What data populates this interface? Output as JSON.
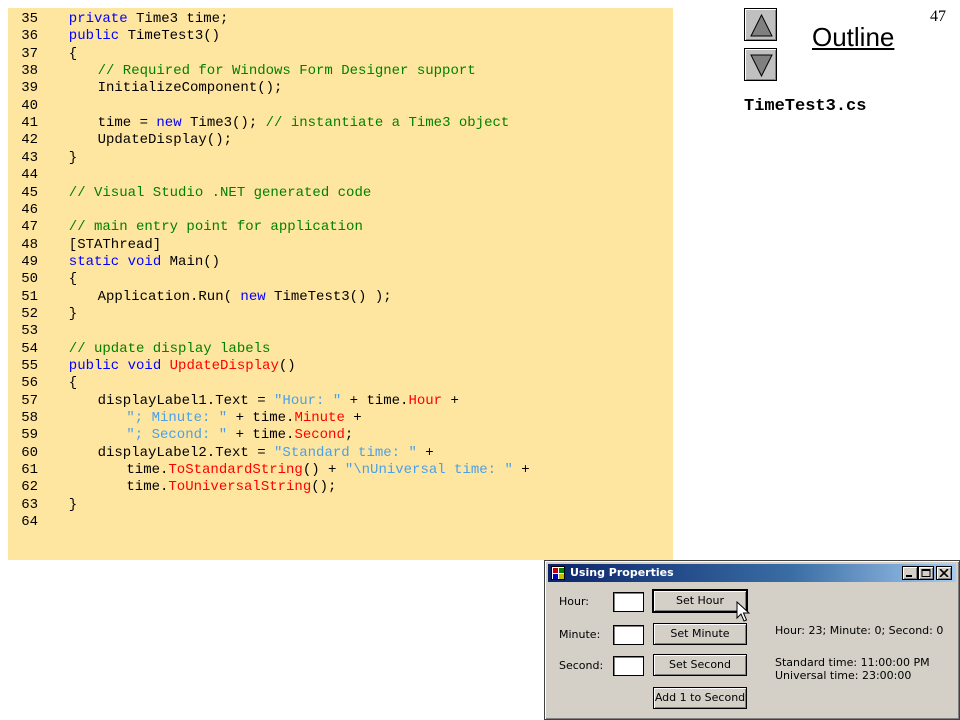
{
  "code_lines": [
    {
      "num": "35",
      "tokens": [
        {
          "t": "private Time3 time;",
          "c": "kw-mix-private"
        }
      ]
    },
    {
      "num": "36",
      "tokens": []
    },
    {
      "num": "37",
      "tokens": []
    },
    {
      "num": "38",
      "tokens": []
    }
  ],
  "code": [
    {
      "num": "35",
      "indent": 3,
      "segs": [
        [
          "kw",
          "private"
        ],
        [
          "plain",
          " Time3 time;"
        ]
      ]
    },
    {
      "num": "36",
      "indent": 3,
      "segs": [
        [
          "kw",
          "public"
        ],
        [
          "plain",
          " TimeTest3()"
        ]
      ]
    },
    {
      "num": "37",
      "indent": 3,
      "segs": [
        [
          "plain",
          "{"
        ]
      ]
    },
    {
      "num": "38",
      "indent": 6,
      "segs": [
        [
          "com",
          "// Required for Windows Form Designer support"
        ]
      ]
    },
    {
      "num": "39",
      "indent": 6,
      "segs": [
        [
          "plain",
          "InitializeComponent();"
        ]
      ]
    },
    {
      "num": "40",
      "indent": 0,
      "segs": []
    },
    {
      "num": "41",
      "indent": 6,
      "segs": [
        [
          "plain",
          "time = "
        ],
        [
          "kw",
          "new"
        ],
        [
          "plain",
          " Time3(); "
        ],
        [
          "com",
          "// instantiate a Time3 object"
        ]
      ]
    },
    {
      "num": "42",
      "indent": 6,
      "segs": [
        [
          "plain",
          "UpdateDisplay();"
        ]
      ]
    },
    {
      "num": "43",
      "indent": 3,
      "segs": [
        [
          "plain",
          "}"
        ]
      ]
    },
    {
      "num": "44",
      "indent": 0,
      "segs": []
    },
    {
      "num": "45",
      "indent": 3,
      "segs": [
        [
          "com",
          "// Visual Studio .NET generated code"
        ]
      ]
    },
    {
      "num": "46",
      "indent": 0,
      "segs": []
    },
    {
      "num": "47",
      "indent": 3,
      "segs": [
        [
          "com",
          "// main entry point for application"
        ]
      ]
    },
    {
      "num": "48",
      "indent": 3,
      "segs": [
        [
          "plain",
          "[STAThread]"
        ]
      ]
    },
    {
      "num": "49",
      "indent": 3,
      "segs": [
        [
          "kw",
          "static"
        ],
        [
          "plain",
          " "
        ],
        [
          "kw",
          "void"
        ],
        [
          "plain",
          " Main()"
        ]
      ]
    },
    {
      "num": "50",
      "indent": 3,
      "segs": [
        [
          "plain",
          "{"
        ]
      ]
    },
    {
      "num": "51",
      "indent": 6,
      "segs": [
        [
          "plain",
          "Application.Run( "
        ],
        [
          "kw",
          "new"
        ],
        [
          "plain",
          " TimeTest3() );"
        ]
      ]
    },
    {
      "num": "52",
      "indent": 3,
      "segs": [
        [
          "plain",
          "}"
        ]
      ]
    },
    {
      "num": "53",
      "indent": 0,
      "segs": []
    },
    {
      "num": "54",
      "indent": 3,
      "segs": [
        [
          "com",
          "// update display labels"
        ]
      ]
    },
    {
      "num": "55",
      "indent": 3,
      "segs": [
        [
          "kw",
          "public"
        ],
        [
          "plain",
          " "
        ],
        [
          "kw",
          "void"
        ],
        [
          "plain",
          " "
        ],
        [
          "red",
          "UpdateDisplay"
        ],
        [
          "plain",
          "()"
        ]
      ]
    },
    {
      "num": "56",
      "indent": 3,
      "segs": [
        [
          "plain",
          "{"
        ]
      ]
    },
    {
      "num": "57",
      "indent": 6,
      "segs": [
        [
          "plain",
          "displayLabel1.Text = "
        ],
        [
          "str",
          "\"Hour: \""
        ],
        [
          "plain",
          " + time."
        ],
        [
          "red",
          "Hour"
        ],
        [
          "plain",
          " +"
        ]
      ]
    },
    {
      "num": "58",
      "indent": 9,
      "segs": [
        [
          "str",
          "\"; Minute: \""
        ],
        [
          "plain",
          " + time."
        ],
        [
          "red",
          "Minute"
        ],
        [
          "plain",
          " +"
        ]
      ]
    },
    {
      "num": "59",
      "indent": 9,
      "segs": [
        [
          "str",
          "\"; Second: \""
        ],
        [
          "plain",
          " + time."
        ],
        [
          "red",
          "Second"
        ],
        [
          "plain",
          ";"
        ]
      ]
    },
    {
      "num": "60",
      "indent": 6,
      "segs": [
        [
          "plain",
          "displayLabel2.Text = "
        ],
        [
          "str",
          "\"Standard time: \""
        ],
        [
          "plain",
          " +"
        ]
      ]
    },
    {
      "num": "61",
      "indent": 9,
      "segs": [
        [
          "plain",
          "time."
        ],
        [
          "red",
          "ToStandardString"
        ],
        [
          "plain",
          "() + "
        ],
        [
          "str",
          "\"\\nUniversal time: \""
        ],
        [
          "plain",
          " +"
        ]
      ]
    },
    {
      "num": "62",
      "indent": 9,
      "segs": [
        [
          "plain",
          "time."
        ],
        [
          "red",
          "ToUniversalString"
        ],
        [
          "plain",
          "();"
        ]
      ]
    },
    {
      "num": "63",
      "indent": 3,
      "segs": [
        [
          "plain",
          "}"
        ]
      ]
    },
    {
      "num": "64",
      "indent": 0,
      "segs": []
    }
  ],
  "slide": {
    "number": "47",
    "outline_label": "Outline",
    "file_name": "TimeTest3.cs",
    "up_icon": "triangle-up-icon",
    "down_icon": "triangle-down-icon"
  },
  "dialog": {
    "title": "Using Properties",
    "labels": {
      "hour": "Hour:",
      "minute": "Minute:",
      "second": "Second:"
    },
    "inputs": {
      "hour": "",
      "minute": "",
      "second": ""
    },
    "buttons": {
      "set_hour": "Set Hour",
      "set_minute": "Set Minute",
      "set_second": "Set Second",
      "add_second": "Add 1 to Second"
    },
    "output": {
      "line1": "Hour: 23; Minute: 0; Second: 0",
      "line2": "Standard time: 11:00:00  PM",
      "line3": "Universal time: 23:00:00"
    }
  },
  "colors": {
    "code_background": "#ffe6a0",
    "keyword": "#0000ff",
    "comment": "#008000",
    "string": "#4aa0e8",
    "highlight": "#ff0000",
    "titlebar": "#0a246a"
  }
}
